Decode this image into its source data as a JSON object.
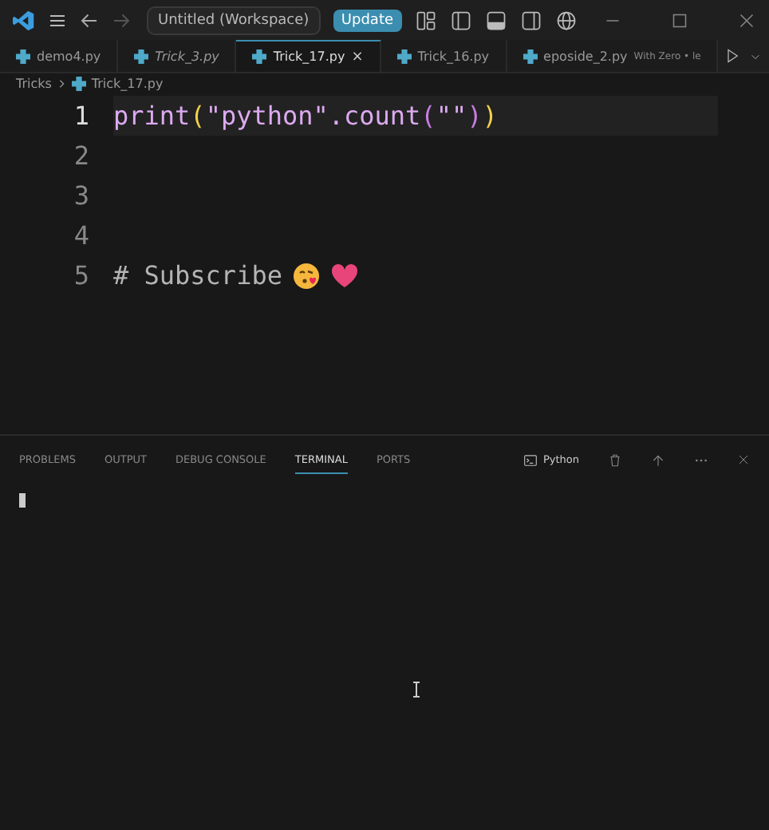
{
  "window": {
    "title": "Untitled (Workspace)",
    "update_button": "Update"
  },
  "tabs": [
    {
      "label": "demo4.py",
      "selected": false,
      "preview": false
    },
    {
      "label": "Trick_3.py",
      "selected": false,
      "preview": true
    },
    {
      "label": "Trick_17.py",
      "selected": true,
      "preview": false,
      "close": "×"
    },
    {
      "label": "Trick_16.py",
      "selected": false,
      "preview": false
    },
    {
      "label": "eposide_2.py",
      "selected": false,
      "preview": false,
      "description": "With Zero • le"
    }
  ],
  "breadcrumb": [
    "Tricks",
    "Trick_17.py"
  ],
  "editor": {
    "lines": [
      {
        "number": "1",
        "active": true,
        "tokens": [
          {
            "text": "print",
            "color": "#dcaaf0"
          },
          {
            "text": "(",
            "color": "#f2d04b"
          },
          {
            "text": "\"python\"",
            "color": "#dcaaf0"
          },
          {
            "text": ".count",
            "color": "#dcaaf0"
          },
          {
            "text": "(",
            "color": "#c87de0"
          },
          {
            "text": "\"\"",
            "color": "#dcaaf0"
          },
          {
            "text": ")",
            "color": "#c87de0"
          },
          {
            "text": ")",
            "color": "#f2d04b"
          }
        ]
      },
      {
        "number": "2",
        "active": false
      },
      {
        "number": "3",
        "active": false
      },
      {
        "number": "4",
        "active": false
      },
      {
        "number": "5",
        "active": false,
        "tokens": [
          {
            "text": "# Subscribe",
            "color": "#b4b4b4"
          }
        ],
        "emoji": true
      }
    ]
  },
  "panel": {
    "tabs": [
      {
        "label": "PROBLEMS",
        "selected": false
      },
      {
        "label": "OUTPUT",
        "selected": false
      },
      {
        "label": "DEBUG CONSOLE",
        "selected": false
      },
      {
        "label": "TERMINAL",
        "selected": true
      },
      {
        "label": "PORTS",
        "selected": false
      }
    ],
    "terminal_name": "Python"
  }
}
